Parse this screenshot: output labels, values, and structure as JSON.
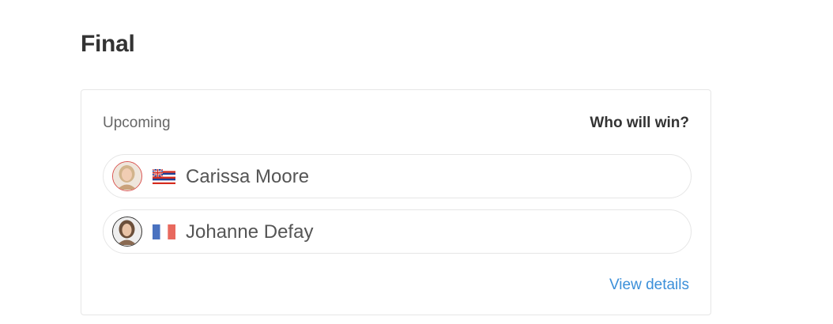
{
  "heading": "Final",
  "card": {
    "status": "Upcoming",
    "prompt": "Who will win?",
    "athletes": [
      {
        "name": "Carissa Moore",
        "avatar_icon": "athlete-photo",
        "avatar_ring_color": "#d9534f",
        "flag_icon": "hawaii-flag-icon"
      },
      {
        "name": "Johanne Defay",
        "avatar_icon": "athlete-photo",
        "avatar_ring_color": "#333333",
        "flag_icon": "france-flag-icon"
      }
    ],
    "details_label": "View details"
  },
  "colors": {
    "link": "#3b8fd9",
    "border": "#e6e6e6",
    "text_primary": "#333333",
    "text_secondary": "#666666"
  }
}
